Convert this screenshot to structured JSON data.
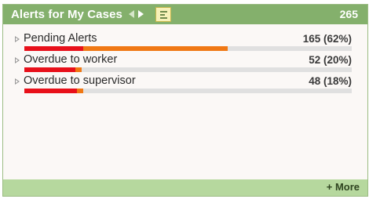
{
  "widget": {
    "title": "Alerts for My Cases",
    "total_count": "265",
    "nav_icons": [
      "nav-left-arrow-icon",
      "nav-right-arrow-icon"
    ],
    "list_view_icon": "list-view-icon"
  },
  "colors": {
    "header_bg": "#84b06c",
    "footer_bg": "#b6d89e",
    "bar_track": "#e0e0e0",
    "bar_red": "#e8101a",
    "bar_orange": "#f07814"
  },
  "alerts": [
    {
      "label": "Pending Alerts",
      "value": "165 (62%)",
      "bar_fraction": {
        "red": 0.18,
        "orange": 0.44
      }
    },
    {
      "label": "Overdue to worker",
      "value": "52 (20%)",
      "bar_fraction": {
        "red": 0.155,
        "orange": 0.02
      }
    },
    {
      "label": "Overdue to supervisor",
      "value": "48 (18%)",
      "bar_fraction": {
        "red": 0.16,
        "orange": 0.02
      }
    }
  ],
  "footer": {
    "more_label": "+ More"
  }
}
